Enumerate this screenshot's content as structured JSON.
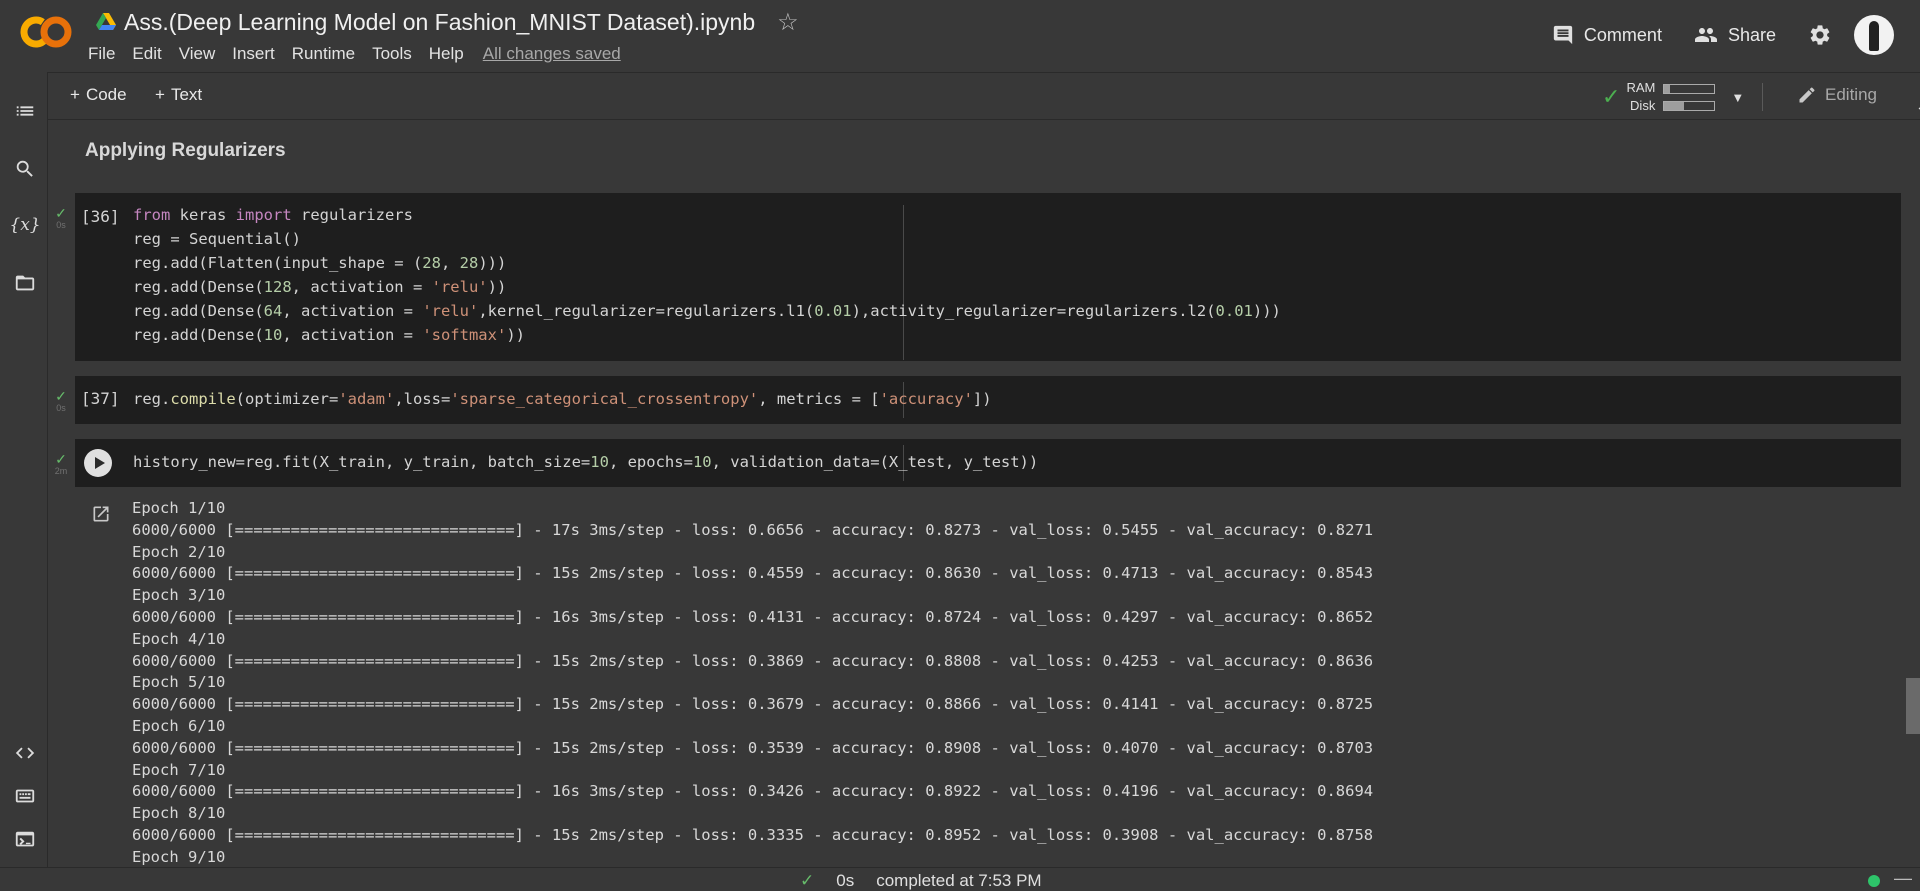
{
  "header": {
    "notebook_title": "Ass.(Deep Learning Model on Fashion_MNIST Dataset).ipynb",
    "menu": [
      "File",
      "Edit",
      "View",
      "Insert",
      "Runtime",
      "Tools",
      "Help"
    ],
    "saved_status": "All changes saved",
    "comment_label": "Comment",
    "share_label": "Share"
  },
  "toolbar": {
    "add_code": "Code",
    "add_text": "Text",
    "ram_label": "RAM",
    "disk_label": "Disk",
    "ram_usage": 0.12,
    "disk_usage": 0.4,
    "mode_label": "Editing"
  },
  "rail": {
    "icons": [
      "table-of-contents-icon",
      "search-icon",
      "variables-icon",
      "files-icon",
      "code-snippets-icon",
      "command-palette-icon",
      "terminal-icon"
    ]
  },
  "notebook": {
    "section_heading": "Applying Regularizers",
    "cells": [
      {
        "exec_count": "[36]",
        "status_time": "0s",
        "lines": [
          "from keras import regularizers",
          "reg = Sequential()",
          "reg.add(Flatten(input_shape = (28, 28)))",
          "reg.add(Dense(128, activation = 'relu'))",
          "reg.add(Dense(64, activation = 'relu',kernel_regularizer=regularizers.l1(0.01),activity_regularizer=regularizers.l2(0.01)))",
          "reg.add(Dense(10, activation = 'softmax'))"
        ]
      },
      {
        "exec_count": "[37]",
        "status_time": "0s",
        "lines": [
          "reg.compile(optimizer='adam',loss='sparse_categorical_crossentropy', metrics = ['accuracy'])"
        ]
      },
      {
        "exec_count": "",
        "status_time": "2m",
        "lines": [
          "history_new=reg.fit(X_train, y_train, batch_size=10, epochs=10, validation_data=(X_test, y_test))"
        ]
      }
    ],
    "output_lines": [
      "Epoch 1/10",
      "6000/6000 [==============================] - 17s 3ms/step - loss: 0.6656 - accuracy: 0.8273 - val_loss: 0.5455 - val_accuracy: 0.8271",
      "Epoch 2/10",
      "6000/6000 [==============================] - 15s 2ms/step - loss: 0.4559 - accuracy: 0.8630 - val_loss: 0.4713 - val_accuracy: 0.8543",
      "Epoch 3/10",
      "6000/6000 [==============================] - 16s 3ms/step - loss: 0.4131 - accuracy: 0.8724 - val_loss: 0.4297 - val_accuracy: 0.8652",
      "Epoch 4/10",
      "6000/6000 [==============================] - 15s 2ms/step - loss: 0.3869 - accuracy: 0.8808 - val_loss: 0.4253 - val_accuracy: 0.8636",
      "Epoch 5/10",
      "6000/6000 [==============================] - 15s 2ms/step - loss: 0.3679 - accuracy: 0.8866 - val_loss: 0.4141 - val_accuracy: 0.8725",
      "Epoch 6/10",
      "6000/6000 [==============================] - 15s 2ms/step - loss: 0.3539 - accuracy: 0.8908 - val_loss: 0.4070 - val_accuracy: 0.8703",
      "Epoch 7/10",
      "6000/6000 [==============================] - 16s 3ms/step - loss: 0.3426 - accuracy: 0.8922 - val_loss: 0.4196 - val_accuracy: 0.8694",
      "Epoch 8/10",
      "6000/6000 [==============================] - 15s 2ms/step - loss: 0.3335 - accuracy: 0.8952 - val_loss: 0.3908 - val_accuracy: 0.8758",
      "Epoch 9/10"
    ]
  },
  "status_bar": {
    "duration": "0s",
    "completed_text": "completed at 7:53 PM"
  },
  "colors": {
    "background": "#383838",
    "cell_background": "#1e1e1e",
    "success": "#66bb6a",
    "keyword": "#c586c0",
    "string": "#ce9178",
    "number": "#b5cea8",
    "logo_orange": "#f9ab00"
  }
}
